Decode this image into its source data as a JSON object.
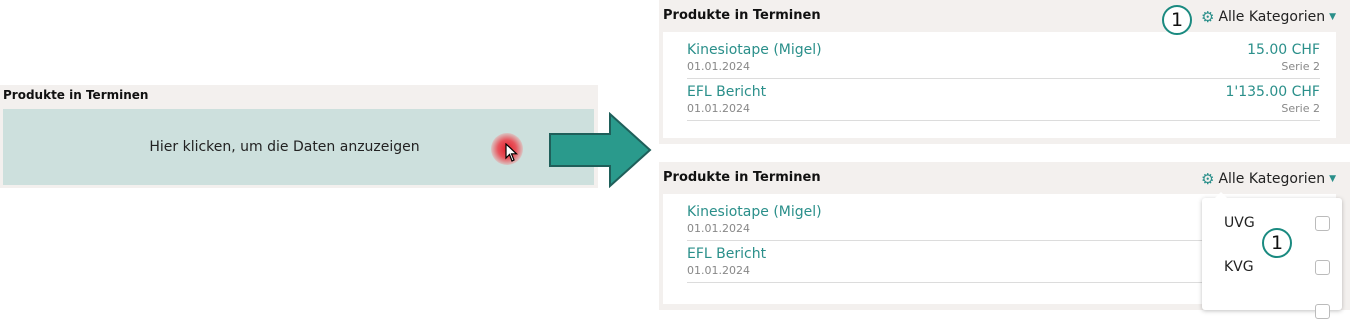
{
  "left_panel": {
    "title": "Produkte in Terminen",
    "load_text": "Hier klicken, um die Daten anzuzeigen"
  },
  "panels": {
    "top": {
      "title": "Produkte in Terminen",
      "category_filter": "Alle Kategorien",
      "items": [
        {
          "name": "Kinesiotape (Migel)",
          "date": "01.01.2024",
          "price": "15.00 CHF",
          "series": "Serie 2"
        },
        {
          "name": "EFL Bericht",
          "date": "01.01.2024",
          "price": "1'135.00 CHF",
          "series": "Serie 2"
        }
      ]
    },
    "bottom": {
      "title": "Produkte in Terminen",
      "category_filter": "Alle Kategorien",
      "items": [
        {
          "name": "Kinesiotape (Migel)",
          "date": "01.01.2024"
        },
        {
          "name": "EFL Bericht",
          "date": "01.01.2024"
        }
      ],
      "dropdown_options": [
        {
          "label": "UVG",
          "checked": false
        },
        {
          "label": "KVG",
          "checked": false
        }
      ]
    }
  },
  "callouts": {
    "top": "1",
    "bottom": "1"
  },
  "colors": {
    "accent": "#2a8f8a",
    "panel_bg": "#f3f0ee",
    "load_area_bg": "#cde0dd",
    "arrow": "#2a9a8c",
    "click_marker": "#e0202b"
  }
}
